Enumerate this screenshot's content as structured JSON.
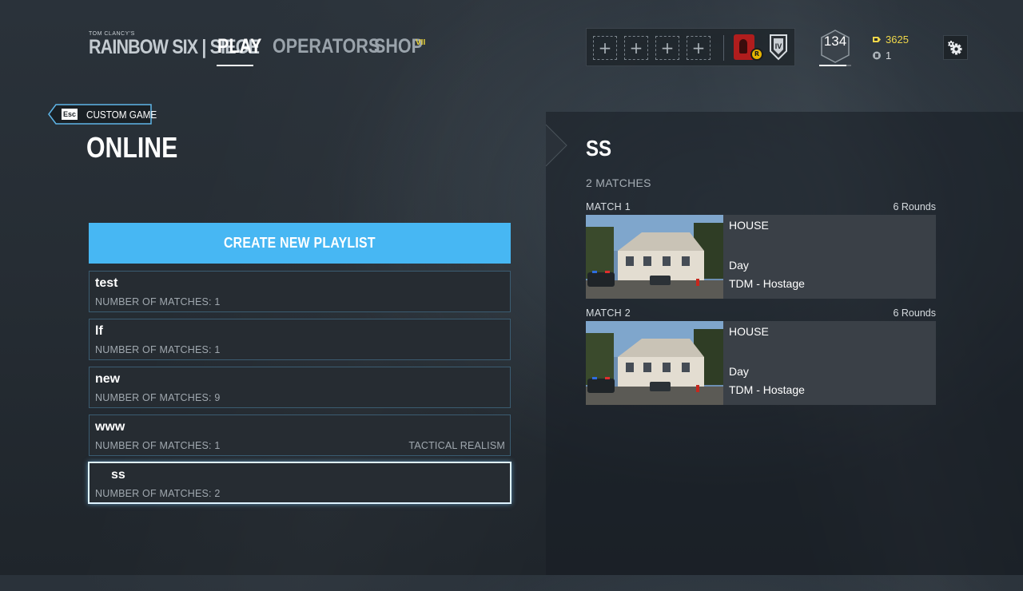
{
  "header": {
    "logo_small": "TOM CLANCY'S",
    "logo_text": "RAINBOW SIX | SIEGE",
    "nav": {
      "play": "PLAY",
      "operators": "OPERATORS",
      "shop": "SHOP"
    },
    "shop_badge": "VII",
    "squad_slots": [
      "+",
      "+",
      "+",
      "+"
    ],
    "operator_badge": "R",
    "rank_label": "IV",
    "level": "134",
    "level_progress": 0.85,
    "renown": "3625",
    "credits": "1"
  },
  "left": {
    "back_key": "Esc",
    "back_label": "CUSTOM GAME",
    "title": "ONLINE",
    "create_button": "CREATE NEW PLAYLIST",
    "playlists": [
      {
        "name": "test",
        "count": "NUMBER OF MATCHES: 1",
        "tag": ""
      },
      {
        "name": "lf",
        "count": "NUMBER OF MATCHES: 1",
        "tag": ""
      },
      {
        "name": "new",
        "count": "NUMBER OF MATCHES: 9",
        "tag": ""
      },
      {
        "name": "www",
        "count": "NUMBER OF MATCHES: 1",
        "tag": "TACTICAL REALISM"
      },
      {
        "name": "ss",
        "count": "NUMBER OF MATCHES: 2",
        "tag": ""
      }
    ]
  },
  "right": {
    "title": "SS",
    "match_count": "2 MATCHES",
    "matches": [
      {
        "label": "MATCH 1",
        "rounds": "6 Rounds",
        "map": "HOUSE",
        "time": "Day",
        "mode": "TDM - Hostage"
      },
      {
        "label": "MATCH 2",
        "rounds": "6 Rounds",
        "map": "HOUSE",
        "time": "Day",
        "mode": "TDM - Hostage"
      }
    ]
  },
  "colors": {
    "accent": "#47b7f3",
    "renown": "#f0d74a",
    "operator": "#b01d1d"
  }
}
